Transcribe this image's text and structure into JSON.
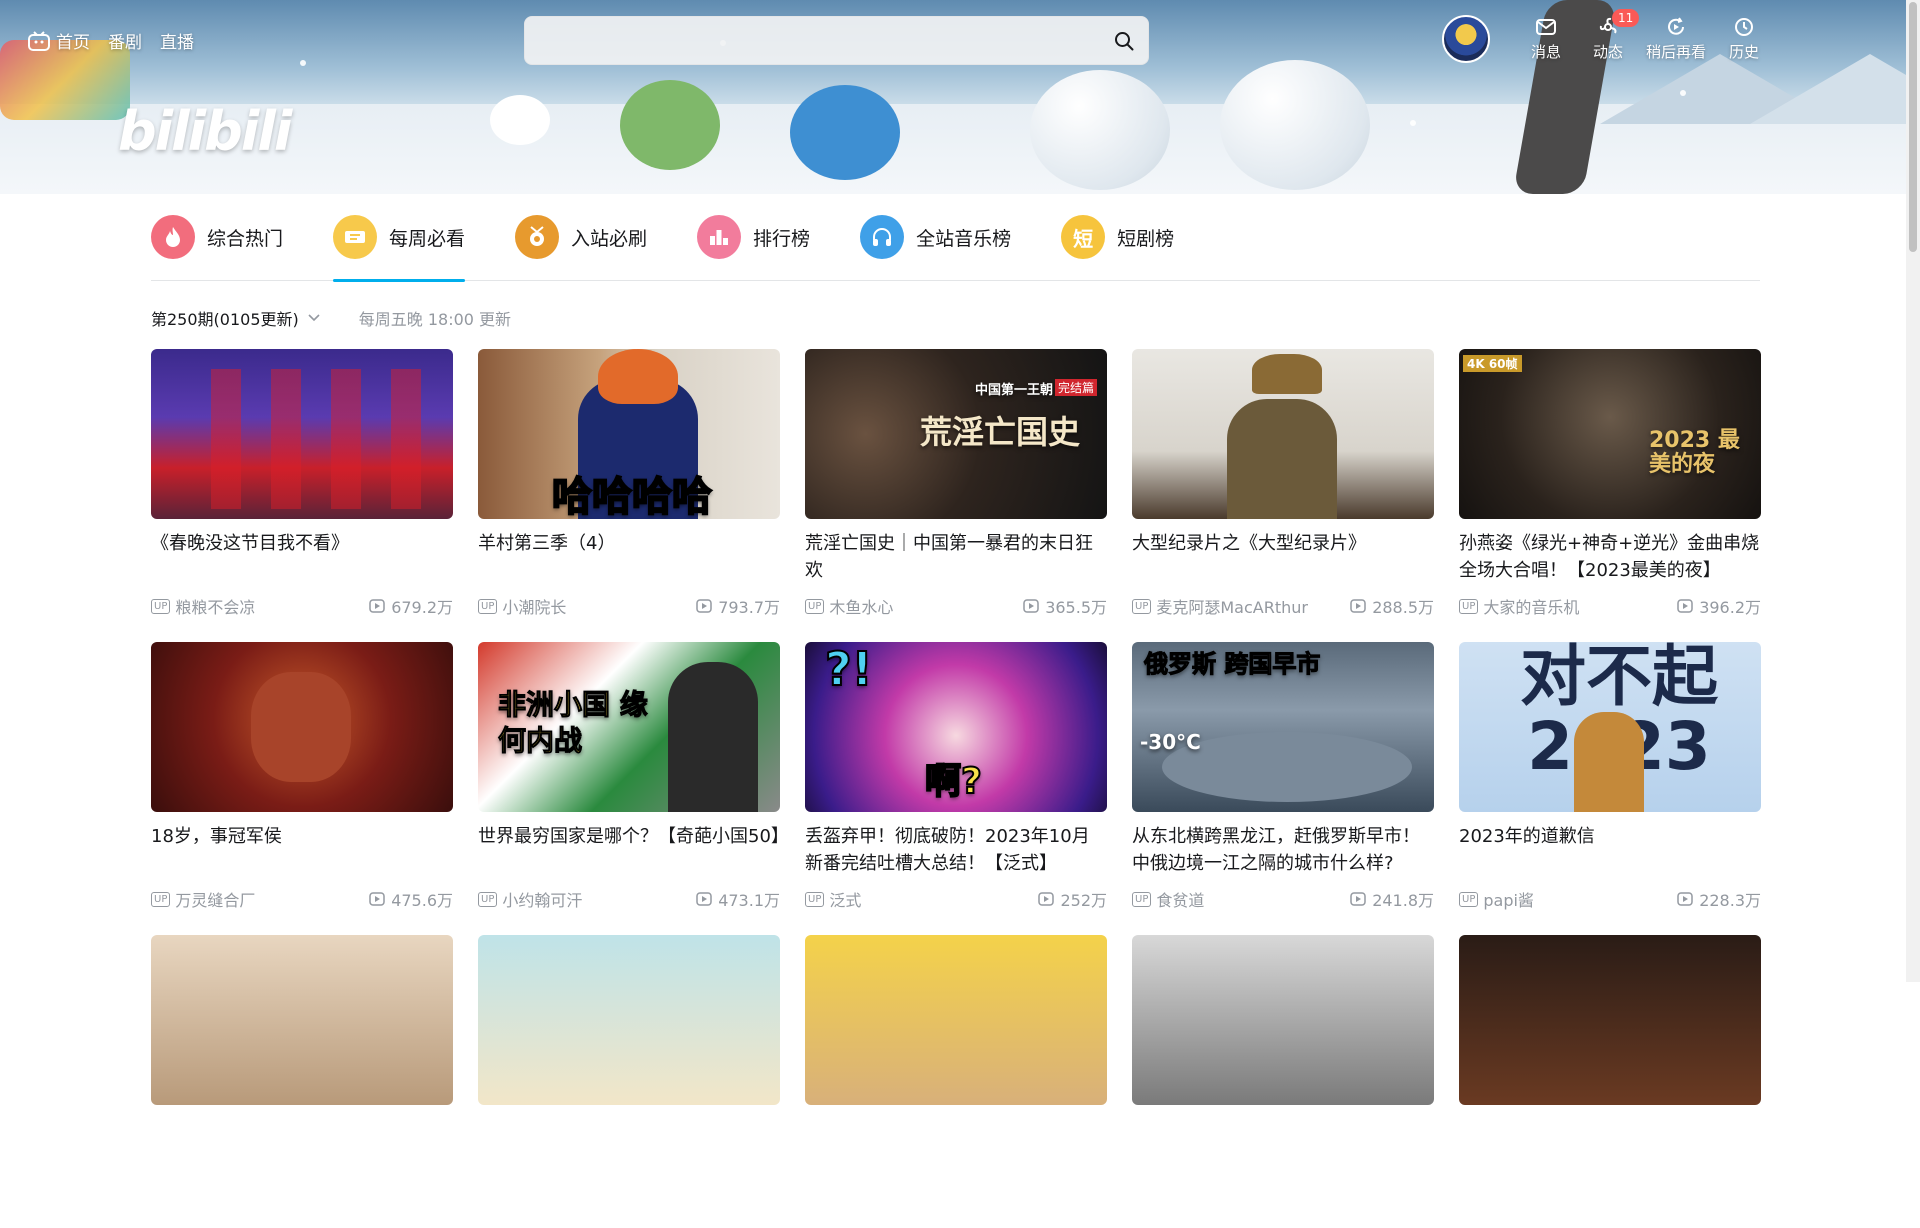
{
  "header": {
    "nav_left": [
      {
        "label": "首页",
        "icon": "tv-icon"
      },
      {
        "label": "番剧"
      },
      {
        "label": "直播"
      }
    ],
    "search": {
      "value": "",
      "placeholder": ""
    },
    "logo_text": "bilibili",
    "nav_right": [
      {
        "label": "消息",
        "icon": "mail-icon"
      },
      {
        "label": "动态",
        "icon": "wind-icon",
        "badge": "11"
      },
      {
        "label": "稍后再看",
        "icon": "play-later-icon"
      },
      {
        "label": "历史",
        "icon": "clock-icon"
      }
    ]
  },
  "tabs": [
    {
      "label": "综合热门",
      "color": "#f26d7d",
      "icon": "flame-icon"
    },
    {
      "label": "每周必看",
      "color": "#f7c94b",
      "icon": "ticket-icon",
      "active": true
    },
    {
      "label": "入站必刷",
      "color": "#e79a2e",
      "icon": "medal-icon"
    },
    {
      "label": "排行榜",
      "color": "#f27c9c",
      "icon": "bars-icon"
    },
    {
      "label": "全站音乐榜",
      "color": "#3fa0e8",
      "icon": "headphones-icon"
    },
    {
      "label": "短剧榜",
      "color": "#f6c43d",
      "icon": "short-drama-icon",
      "icon_text": "短"
    }
  ],
  "period": {
    "selected": "第250期(0105更新)",
    "note": "每周五晚 18:00 更新"
  },
  "accent_color": "#00aeec",
  "cards": [
    {
      "title": "《春晚没这节目我不看》",
      "up": "粮粮不会凉",
      "views": "679.2万"
    },
    {
      "title": "羊村第三季（4）",
      "up": "小潮院长",
      "views": "793.7万",
      "thumb_text": "哈哈哈哈"
    },
    {
      "title": "荒淫亡国史｜中国第一暴君的末日狂欢",
      "up": "木鱼水心",
      "views": "365.5万",
      "thumb_text": "荒淫亡国史",
      "thumb_sub": "中国第一王朝",
      "thumb_tag": "完结篇"
    },
    {
      "title": "大型纪录片之《大型纪录片》",
      "up": "麦克阿瑟MacARthur",
      "views": "288.5万"
    },
    {
      "title": "孙燕姿《绿光+神奇+逆光》金曲串烧全场大合唱！【2023最美的夜】",
      "up": "大家的音乐机",
      "views": "396.2万",
      "thumb_tag": "4K 60帧",
      "thumb_text": "2023 最美的夜"
    },
    {
      "title": "18岁，事冠军侯",
      "up": "万灵缝合厂",
      "views": "475.6万"
    },
    {
      "title": "世界最穷国家是哪个？【奇葩小国50】",
      "up": "小约翰可汗",
      "views": "473.1万",
      "thumb_text": "非洲小国 缘何内战"
    },
    {
      "title": "丢盔弃甲！彻底破防！2023年10月新番完结吐槽大总结！【泛式】",
      "up": "泛式",
      "views": "252万",
      "thumb_text": "啊?"
    },
    {
      "title": "从东北横跨黑龙江，赶俄罗斯早市！中俄边境一江之隔的城市什么样?",
      "up": "食贫道",
      "views": "241.8万",
      "thumb_text": "俄罗斯 跨国早市",
      "thumb_sub": "-30°C"
    },
    {
      "title": "2023年的道歉信",
      "up": "papi酱",
      "views": "228.3万",
      "thumb_text": "对不起 2023"
    }
  ]
}
